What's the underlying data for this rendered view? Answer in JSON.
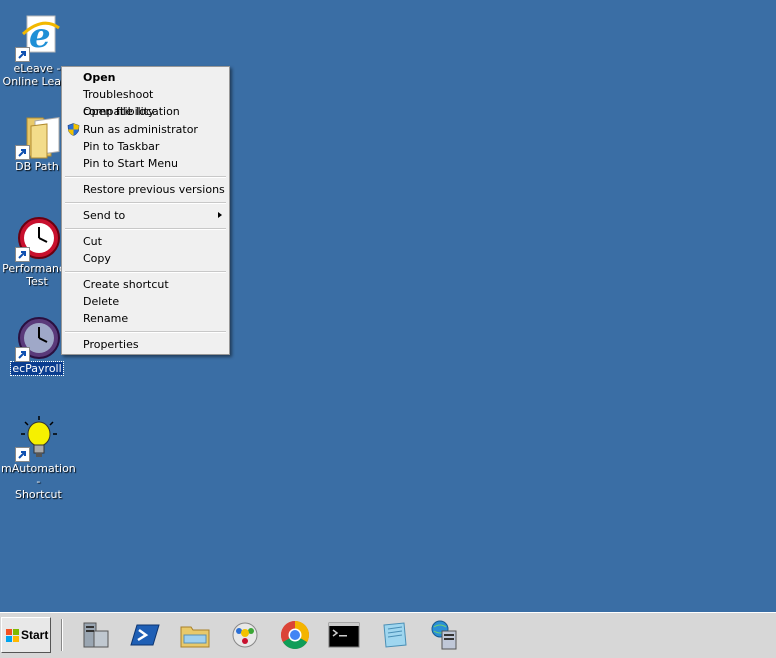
{
  "desktop": {
    "icons": [
      {
        "label": "eLeave -\nOnline Lea...",
        "icon": "internet-explorer-icon"
      },
      {
        "label": "DB Path",
        "icon": "folder-icon"
      },
      {
        "label": "Performance\nTest",
        "icon": "clock-icon"
      },
      {
        "label": "ecPayroll",
        "icon": "clock-icon"
      },
      {
        "label": "mAutomation -\nShortcut",
        "icon": "lightbulb-icon"
      }
    ]
  },
  "context_menu": {
    "items": [
      {
        "label": "Open"
      },
      {
        "label": "Troubleshoot compatibility"
      },
      {
        "label": "Open file location"
      },
      {
        "label": "Run as administrator"
      },
      {
        "label": "Pin to Taskbar"
      },
      {
        "label": "Pin to Start Menu"
      },
      {
        "label": "Restore previous versions"
      },
      {
        "label": "Send to"
      },
      {
        "label": "Cut"
      },
      {
        "label": "Copy"
      },
      {
        "label": "Create shortcut"
      },
      {
        "label": "Delete"
      },
      {
        "label": "Rename"
      },
      {
        "label": "Properties"
      }
    ]
  },
  "taskbar": {
    "start_label": "Start",
    "pinned": [
      "server-manager-icon",
      "powershell-icon",
      "file-explorer-icon",
      "paint-icon",
      "chrome-icon",
      "command-prompt-icon",
      "notepad-icon",
      "network-server-icon"
    ]
  }
}
